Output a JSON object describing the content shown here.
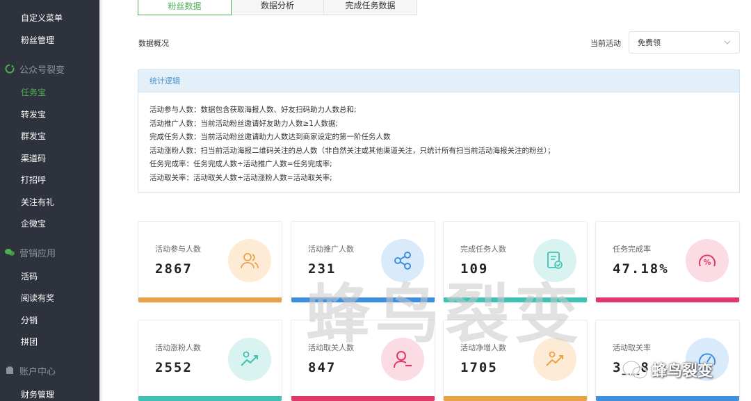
{
  "sidebar": {
    "items_top": [
      {
        "label": "自定义菜单"
      },
      {
        "label": "粉丝管理"
      }
    ],
    "group_fission": {
      "label": "公众号裂变",
      "icon": "recycle-icon"
    },
    "fission_items": [
      {
        "label": "任务宝",
        "active": true
      },
      {
        "label": "转发宝"
      },
      {
        "label": "群发宝"
      },
      {
        "label": "渠道码"
      },
      {
        "label": "打招呼"
      },
      {
        "label": "关注有礼"
      },
      {
        "label": "企微宝"
      }
    ],
    "group_marketing": {
      "label": "营销应用",
      "icon": "chat-icon"
    },
    "marketing_items": [
      {
        "label": "活码"
      },
      {
        "label": "阅读有奖"
      },
      {
        "label": "分销"
      },
      {
        "label": "拼团"
      }
    ],
    "group_account": {
      "label": "账户中心",
      "icon": "account-icon"
    },
    "account_items": [
      {
        "label": "财务管理"
      }
    ],
    "active_color": "#4caf50"
  },
  "tabs": [
    {
      "label": "粉丝数据",
      "active": true
    },
    {
      "label": "数据分析"
    },
    {
      "label": "完成任务数据"
    }
  ],
  "overview": {
    "title": "数据概况"
  },
  "activity_filter": {
    "label": "当前活动",
    "value": "免费领"
  },
  "logic": {
    "title": "统计逻辑",
    "lines": [
      "活动参与人数：数据包含获取海报人数、好友扫码助力人数总和;",
      "活动推广人数：当前活动粉丝邀请好友助力人数≥1人数据;",
      "完成任务人数：当前活动粉丝邀请助力人数达到商家设定的第一阶任务人数",
      "活动涨粉人数：扫当前活动海报二维码关注的总人数（非自然关注或其他渠道关注，只统计所有扫当前活动海报关注的粉丝）；",
      "任务完成率：任务完成人数÷活动推广人数=任务完成率;",
      "活动取关率：活动取关人数÷活动涨粉人数=活动取关率;"
    ]
  },
  "cards": [
    {
      "label": "活动参与人数",
      "value": "2867",
      "icon": "users-icon",
      "bar_color": "#e8a346",
      "icon_bg": "#fdebd6",
      "icon_color": "#e8a346"
    },
    {
      "label": "活动推广人数",
      "value": "231",
      "icon": "share-icon",
      "bar_color": "#3f8fe0",
      "icon_bg": "#d9eafa",
      "icon_color": "#3f8fe0"
    },
    {
      "label": "完成任务人数",
      "value": "109",
      "icon": "task-done-icon",
      "bar_color": "#3fc1b5",
      "icon_bg": "#d9f3f0",
      "icon_color": "#3fc1b5"
    },
    {
      "label": "任务完成率",
      "value": "47.18%",
      "icon": "percent-gauge-icon",
      "bar_color": "#e0386a",
      "icon_bg": "#fbdbe4",
      "icon_color": "#e0386a"
    },
    {
      "label": "活动涨粉人数",
      "value": "2552",
      "icon": "trend-up-icon",
      "bar_color": "#3fc1b5",
      "icon_bg": "#d9f3f0",
      "icon_color": "#3fc1b5"
    },
    {
      "label": "活动取关人数",
      "value": "847",
      "icon": "user-minus-icon",
      "bar_color": "#e0386a",
      "icon_bg": "#fbdbe4",
      "icon_color": "#e0386a"
    },
    {
      "label": "活动净增人数",
      "value": "1705",
      "icon": "trend-chart-icon",
      "bar_color": "#e8a346",
      "icon_bg": "#fdebd6",
      "icon_color": "#e8a346"
    },
    {
      "label": "活动取关率",
      "value": "3__8",
      "icon": "gauge-icon",
      "bar_color": "#3f8fe0",
      "icon_bg": "#d9eafa",
      "icon_color": "#3f8fe0"
    }
  ],
  "watermark": {
    "text": "蜂鸟裂变",
    "badge_text": "蜂鸟裂变"
  }
}
